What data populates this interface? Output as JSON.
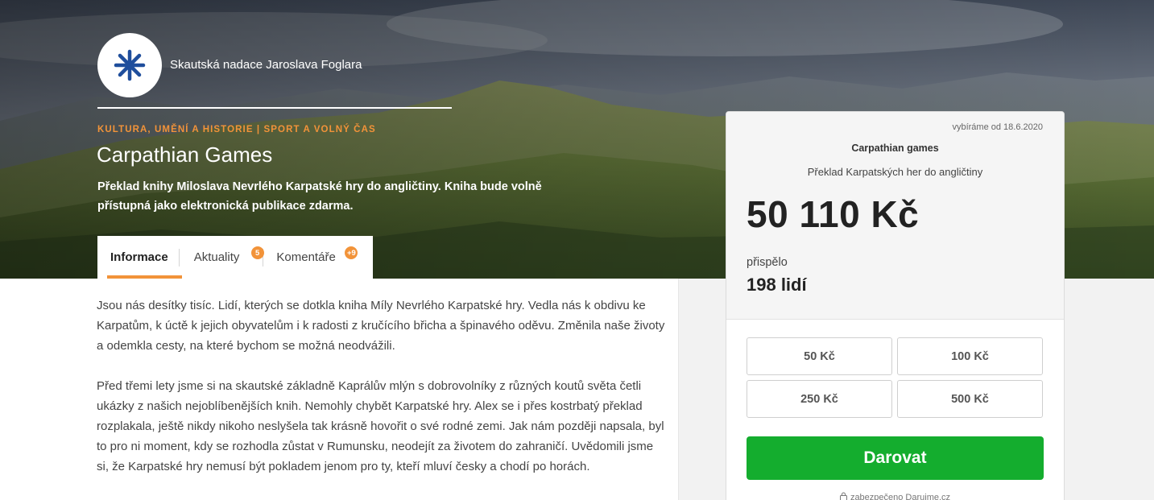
{
  "hero": {
    "org_name": "Skautská nadace Jaroslava Foglara",
    "categories": "KULTURA, UMĚNÍ A HISTORIE | SPORT A VOLNÝ ČAS",
    "title": "Carpathian Games",
    "subtitle": "Překlad knihy Miloslava Nevrlého Karpatské hry do angličtiny. Kniha bude volně přístupná jako elektronická publikace zdarma."
  },
  "tabs": [
    {
      "label": "Informace",
      "active": true
    },
    {
      "label": "Aktuality",
      "badge": "5"
    },
    {
      "label": "Komentáře",
      "badge": "+9"
    }
  ],
  "content": {
    "paragraphs": [
      "Jsou nás desítky tisíc. Lidí, kterých se dotkla kniha Míly Nevrlého Karpatské hry. Vedla nás k obdivu ke Karpatům, k úctě k jejich obyvatelům i k radosti z kručícího břicha a špinavého oděvu. Změnila naše životy a odemkla cesty, na které bychom se možná neodvážili.",
      "Před třemi lety jsme si na skautské základně Kaprálův mlýn s dobrovolníky z různých koutů světa četli ukázky z našich nejoblíbenějších knih. Nemohly chybět Karpatské hry. Alex se i přes kostrbatý překlad rozplakala, ještě nikdy nikoho neslyšela tak krásně hovořit o své rodné zemi. Jak nám později napsala, byl to pro ni moment, kdy se rozhodla zůstat v Rumunsku, neodejít za životem do zahraničí. Uvědomili jsme si, že Karpatské hry nemusí být pokladem jenom pro ty, kteří mluví česky a chodí po horách."
    ]
  },
  "donation_card": {
    "since": "vybíráme od 18.6.2020",
    "title": "Carpathian games",
    "subtitle": "Překlad Karpatských her do angličtiny",
    "amount": "50 110 Kč",
    "contributed_label": "přispělo",
    "contributed_count": "198 lidí",
    "amount_options": [
      "50 Kč",
      "100 Kč",
      "250 Kč",
      "500 Kč"
    ],
    "donate_label": "Darovat",
    "secured_text": "zabezpečeno Darujme.cz"
  },
  "colors": {
    "accent": "#f29339",
    "donate": "#14ad2e",
    "logo": "#1f4e9c"
  },
  "icons": [
    "scout-lily-logo-icon",
    "lock-icon"
  ]
}
